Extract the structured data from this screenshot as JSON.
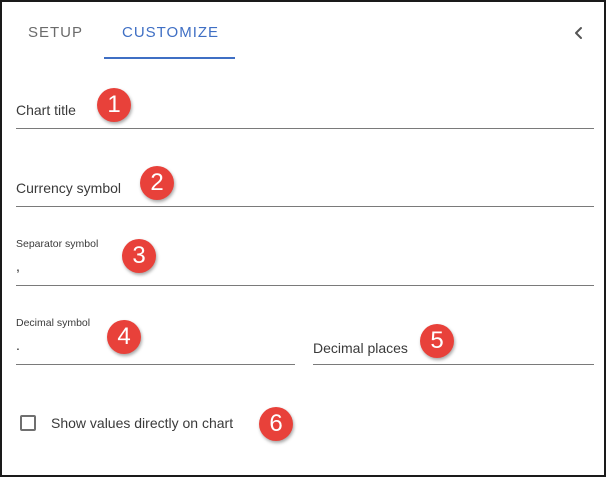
{
  "tabs": {
    "setup_label": "SETUP",
    "customize_label": "CUSTOMIZE",
    "active": "CUSTOMIZE"
  },
  "header": {
    "collapse_icon": "chevron-left-icon"
  },
  "fields": {
    "chart_title": {
      "label": "Chart title",
      "value": ""
    },
    "currency_symbol": {
      "label": "Currency symbol",
      "value": ""
    },
    "separator_symbol": {
      "label": "Separator symbol",
      "value": ","
    },
    "decimal_symbol": {
      "label": "Decimal symbol",
      "value": "."
    },
    "decimal_places": {
      "label": "Decimal places",
      "value": ""
    }
  },
  "checkbox": {
    "label": "Show values directly on chart",
    "checked": false
  },
  "annotations": [
    "1",
    "2",
    "3",
    "4",
    "5",
    "6"
  ],
  "colors": {
    "accent": "#3f6fc4",
    "badge": "#e8413a",
    "border": "#1a1a1a"
  }
}
